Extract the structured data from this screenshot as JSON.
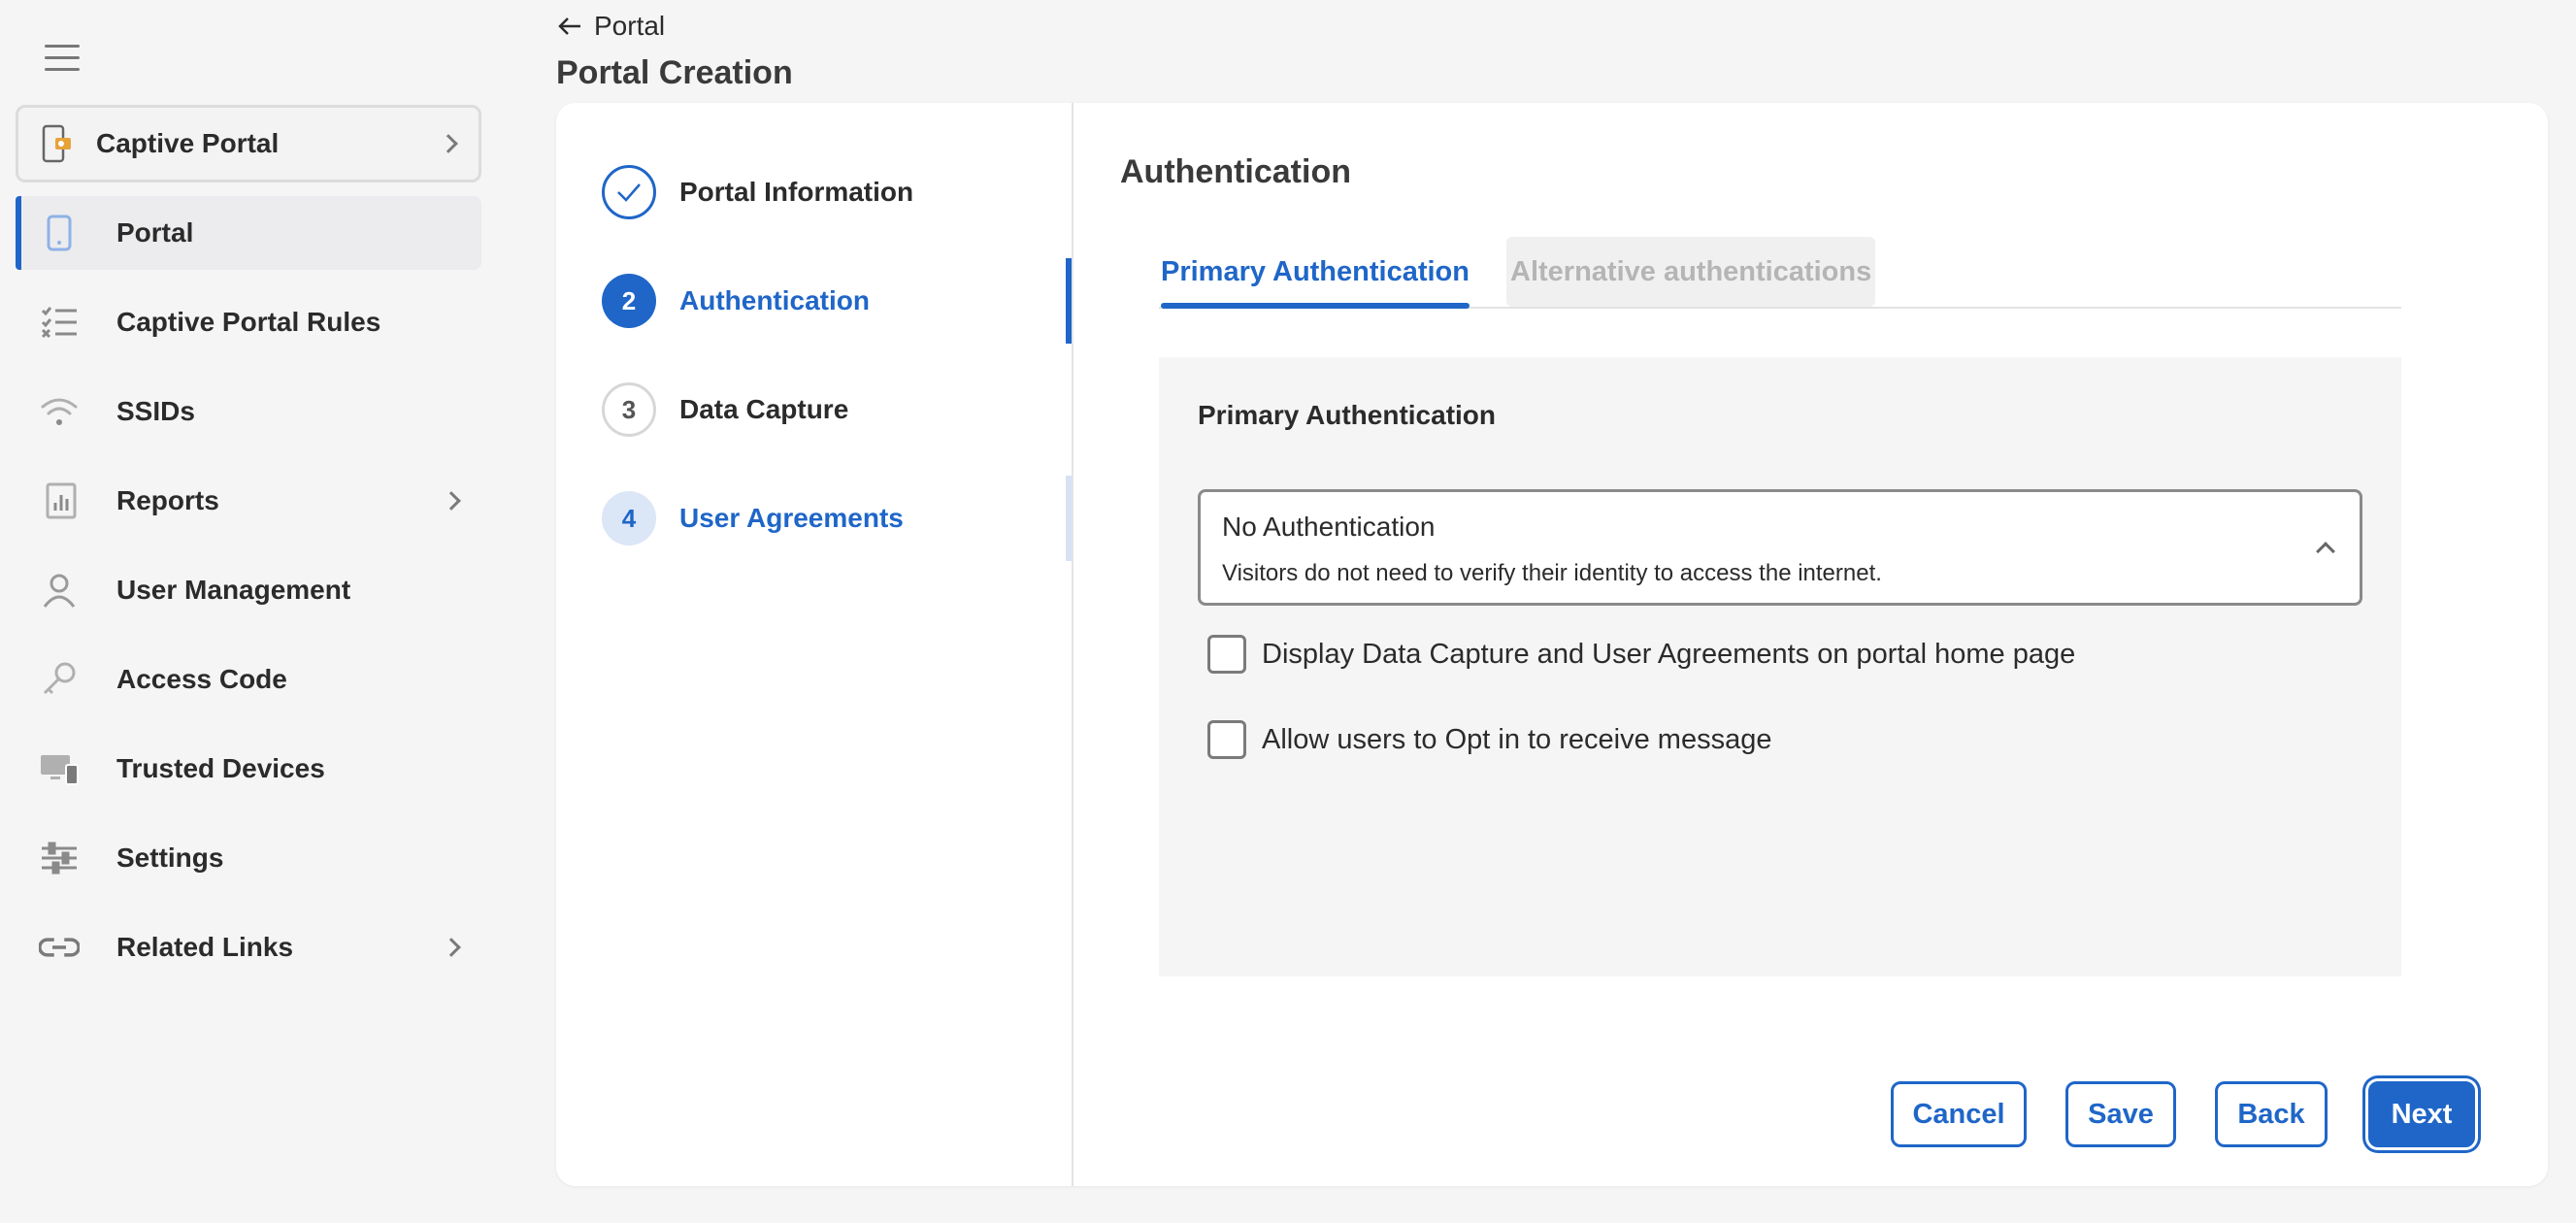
{
  "sidebar": {
    "app": {
      "label": "Captive Portal",
      "icon": "captive-portal-icon"
    },
    "items": [
      {
        "label": "Portal",
        "icon": "phone-icon",
        "active": true
      },
      {
        "label": "Captive Portal Rules",
        "icon": "checklist-icon"
      },
      {
        "label": "SSIDs",
        "icon": "wifi-icon"
      },
      {
        "label": "Reports",
        "icon": "reports-icon",
        "has_submenu": true
      },
      {
        "label": "User Management",
        "icon": "user-icon"
      },
      {
        "label": "Access Code",
        "icon": "key-icon"
      },
      {
        "label": "Trusted Devices",
        "icon": "devices-icon"
      },
      {
        "label": "Settings",
        "icon": "sliders-icon"
      },
      {
        "label": "Related Links",
        "icon": "link-icon",
        "has_submenu": true
      }
    ]
  },
  "header": {
    "back_label": "Portal",
    "title": "Portal Creation"
  },
  "steps": [
    {
      "number": "1",
      "label": "Portal Information",
      "state": "completed"
    },
    {
      "number": "2",
      "label": "Authentication",
      "state": "active"
    },
    {
      "number": "3",
      "label": "Data Capture",
      "state": "pending"
    },
    {
      "number": "4",
      "label": "User Agreements",
      "state": "upcoming"
    }
  ],
  "main": {
    "title": "Authentication",
    "tabs": [
      {
        "label": "Primary Authentication",
        "selected": true
      },
      {
        "label": "Alternative authentications",
        "selected": false
      }
    ],
    "panel": {
      "title": "Primary Authentication",
      "select": {
        "value": "No Authentication",
        "description": "Visitors do not need to verify their identity to access the internet."
      },
      "checkboxes": [
        {
          "label": "Display Data Capture and User Agreements on portal home page",
          "checked": false
        },
        {
          "label": "Allow users to Opt in to receive message",
          "checked": false
        }
      ]
    }
  },
  "buttons": {
    "cancel": "Cancel",
    "save": "Save",
    "back": "Back",
    "next": "Next"
  },
  "colors": {
    "accent": "#1f66c8",
    "background": "#f5f5f6",
    "card": "#ffffff"
  }
}
